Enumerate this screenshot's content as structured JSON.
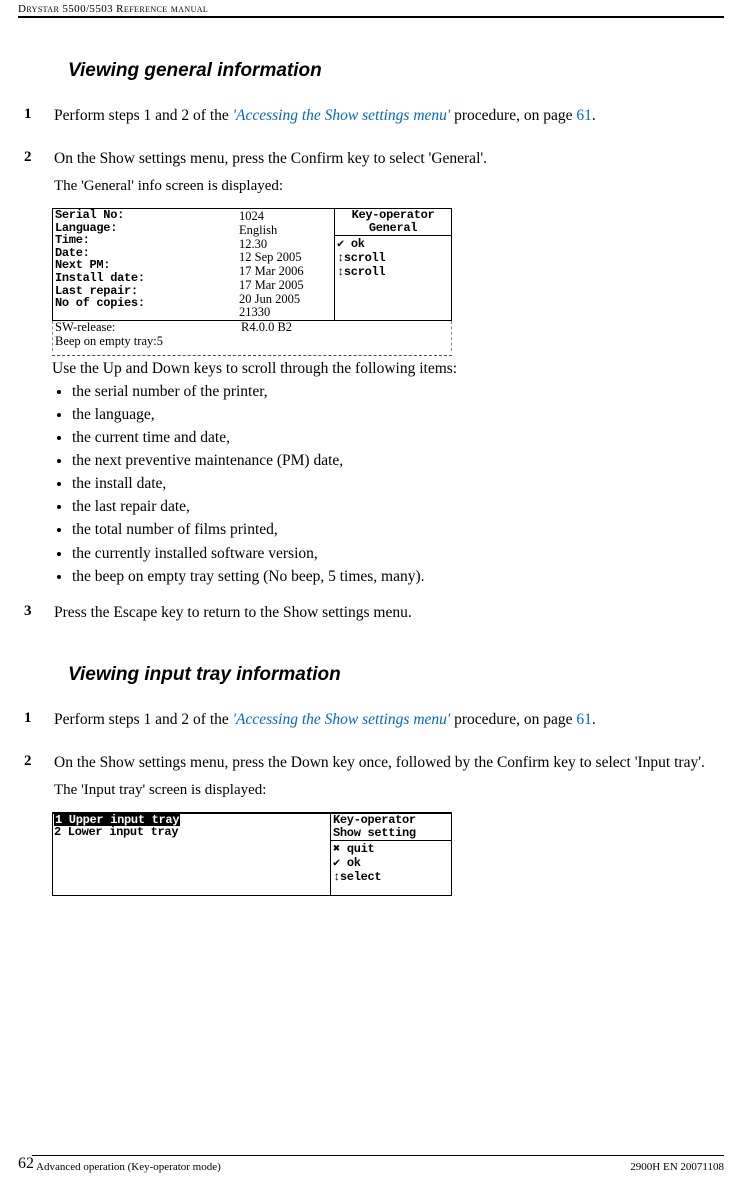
{
  "running_head": "Drystar 5500/5503 Reference manual",
  "section1": {
    "title": "Viewing general information",
    "step1": {
      "num": "1",
      "pre": "Perform steps 1 and 2 of the ",
      "link": "'Accessing the Show settings menu'",
      "mid": " procedure, on page ",
      "page": "61",
      "post": "."
    },
    "step2": {
      "num": "2",
      "text": "On the Show settings menu, press the Confirm key to select 'General'.",
      "sub": "The 'General' info screen is displayed:"
    },
    "lcd": {
      "labels": [
        "Serial No:",
        "Language:",
        "Time:",
        "Date:",
        "Next PM:",
        "Install date:",
        "Last repair:",
        "No of copies:"
      ],
      "values": [
        "1024",
        "English",
        "12.30",
        "12 Sep 2005",
        "17 Mar 2006",
        "17 Mar 2005",
        "20 Jun 2005",
        "21330"
      ],
      "right_top": [
        "Key-operator",
        "General"
      ],
      "right_bot": [
        "✔ ok",
        "↕scroll",
        "↕scroll"
      ],
      "extra_lbl": [
        "SW-release:",
        "Beep on empty tray:"
      ],
      "extra_val": [
        "R4.0.0 B2",
        "5"
      ]
    },
    "after": "Use the Up and Down keys to scroll through the following items:",
    "bullets": [
      "the serial number of the printer,",
      "the language,",
      "the current time and date,",
      "the next preventive maintenance (PM) date,",
      "the install date,",
      "the last repair date,",
      "the total number of films printed,",
      "the currently installed software version,",
      "the beep on empty tray setting (No beep, 5 times, many)."
    ],
    "step3": {
      "num": "3",
      "text": "Press the Escape key to return to the Show settings menu."
    }
  },
  "section2": {
    "title": "Viewing input tray information",
    "step1": {
      "num": "1",
      "pre": "Perform steps 1 and 2 of the ",
      "link": "'Accessing the Show settings menu'",
      "mid": " procedure, on page ",
      "page": "61",
      "post": "."
    },
    "step2": {
      "num": "2",
      "text": "On the Show settings menu, press the Down key once, followed by the Confirm key to select 'Input tray'.",
      "sub": "The 'Input tray' screen is displayed:"
    },
    "menu2": {
      "line1": "1 Upper input tray",
      "line2": "2 Lower input tray",
      "right_top": [
        "Key-operator",
        "Show setting"
      ],
      "right_bot": [
        "✖ quit",
        "✔ ok",
        "↕select"
      ]
    }
  },
  "footer": {
    "page": "62",
    "left": "Advanced operation (Key-operator mode)",
    "right": "2900H EN 20071108"
  }
}
